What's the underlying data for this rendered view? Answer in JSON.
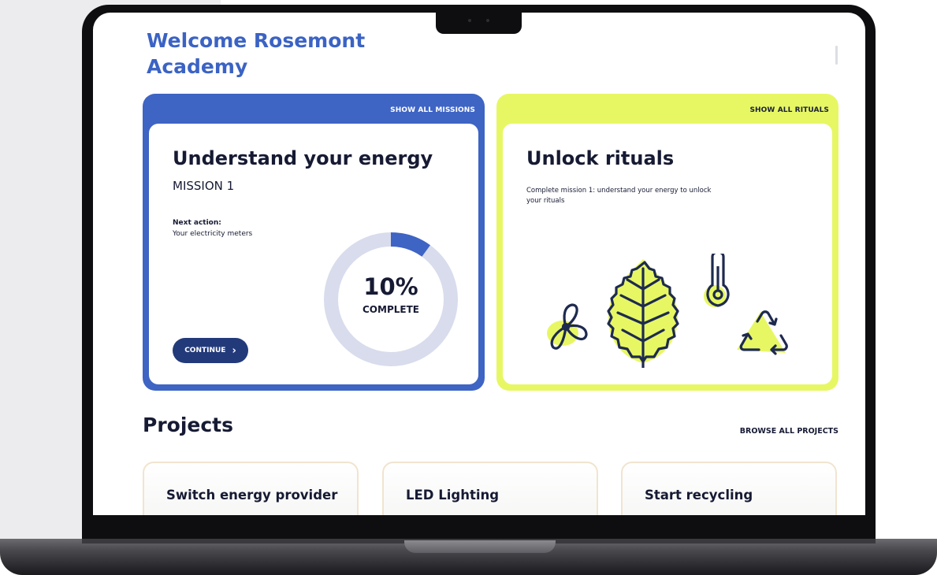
{
  "welcome": {
    "title": "Welcome Rosemont Academy"
  },
  "missions": {
    "show_all": "SHOW ALL MISSIONS",
    "title": "Understand your energy",
    "subtitle": "MISSION 1",
    "next_action_label": "Next action:",
    "next_action_value": "Your electricity meters",
    "progress_fraction": 0.1,
    "progress_percent_text": "10%",
    "progress_label": "COMPLETE",
    "continue_label": "CONTINUE",
    "continue_chevron": "›",
    "colors": {
      "accent": "#3e64c4",
      "button": "#233a7a",
      "track": "#d8dcec"
    }
  },
  "rituals": {
    "show_all": "SHOW ALL RITUALS",
    "title": "Unlock rituals",
    "description": "Complete mission 1: understand your energy to unlock your rituals",
    "icons": [
      "fan-icon",
      "leaf-icon",
      "thermometer-icon",
      "recycle-icon"
    ],
    "colors": {
      "accent": "#e7f764"
    }
  },
  "projects": {
    "title": "Projects",
    "browse_all": "BROWSE ALL PROJECTS",
    "items": [
      {
        "title": "Switch energy provider"
      },
      {
        "title": "LED Lighting"
      },
      {
        "title": "Start recycling"
      }
    ]
  }
}
